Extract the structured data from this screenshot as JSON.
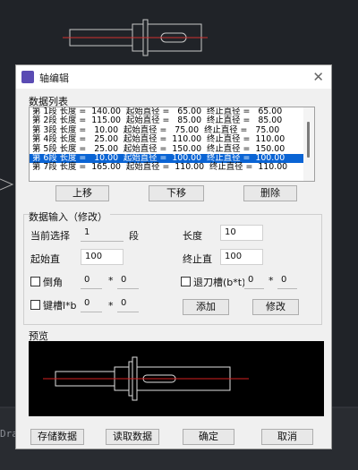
{
  "background": {
    "status_text": "Dra"
  },
  "dialog": {
    "title": "轴编辑",
    "close": "✕",
    "list_label": "数据列表",
    "rows": [
      "第 1段 长度 =  140.00  起始直径 =   65.00  终止直径 =   65.00",
      "第 2段 长度 =  115.00  起始直径 =   85.00  终止直径 =   85.00",
      "第 3段 长度 =   10.00  起始直径 =   75.00  终止直径 =   75.00",
      "第 4段 长度 =   25.00  起始直径 =  110.00  终止直径 =  110.00",
      "第 5段 长度 =   25.00  起始直径 =  150.00  终止直径 =  150.00",
      "第 6段 长度 =   10.00  起始直径 =  100.00  终止直径 =  100.00",
      "第 7段 长度 =  165.00  起始直径 =  110.00  终止直径 =  110.00"
    ],
    "selected_row": 5,
    "buttons": {
      "up": "上移",
      "down": "下移",
      "delete": "删除"
    },
    "input_label": "数据输入（修改）",
    "current_label": "当前选择",
    "current_value": "1",
    "segment_unit": "段",
    "length_label": "长度",
    "length_value": "10",
    "start_label": "起始直",
    "start_value": "100",
    "end_label": "终止直",
    "end_value": "100",
    "chamfer_label": "倒角",
    "chamfer_a": "0",
    "chamfer_b": "0",
    "undercut_label": "退刀槽(b*t)",
    "undercut_a": "0",
    "undercut_b": "0",
    "keyway_label": "键槽l*b",
    "keyway_a": "0",
    "keyway_b": "0",
    "times_sign": "*",
    "add_button": "添加",
    "modify_button": "修改",
    "preview_label": "预览",
    "save_button": "存储数据",
    "load_button": "读取数据",
    "ok_button": "确定",
    "cancel_button": "取消"
  }
}
